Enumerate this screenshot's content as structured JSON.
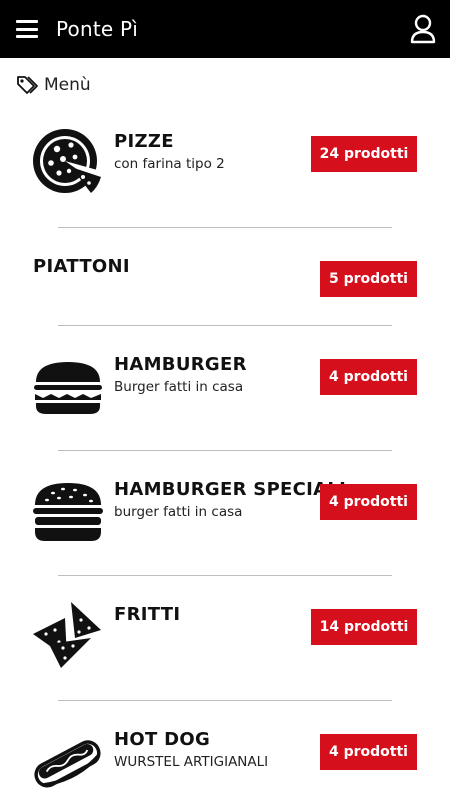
{
  "app": {
    "title": "Ponte Pì"
  },
  "header_icons": {
    "menu": "hamburger-menu-icon",
    "account": "user-icon"
  },
  "section": {
    "icon": "tag-icon",
    "title": "Menù"
  },
  "colors": {
    "topbar": "#000000",
    "accent": "#d50f1c"
  },
  "categories": [
    {
      "name": "PIZZE",
      "subtitle": "con farina tipo 2",
      "count_label": "24 prodotti",
      "icon": "pizza-icon"
    },
    {
      "name": "PIATTONI",
      "subtitle": "",
      "count_label": "5 prodotti",
      "icon": ""
    },
    {
      "name": "HAMBURGER",
      "subtitle": "Burger fatti in casa",
      "count_label": "4 prodotti",
      "icon": "hamburger-icon"
    },
    {
      "name": "HAMBURGER SPECIALI",
      "subtitle": "burger fatti in casa",
      "count_label": "4 prodotti",
      "icon": "burger-sesame-icon"
    },
    {
      "name": "FRITTI",
      "subtitle": "",
      "count_label": "14 prodotti",
      "icon": "nachos-icon"
    },
    {
      "name": "HOT DOG",
      "subtitle": "WURSTEL ARTIGIANALI",
      "count_label": "4 prodotti",
      "icon": "hot-dog-icon"
    }
  ]
}
